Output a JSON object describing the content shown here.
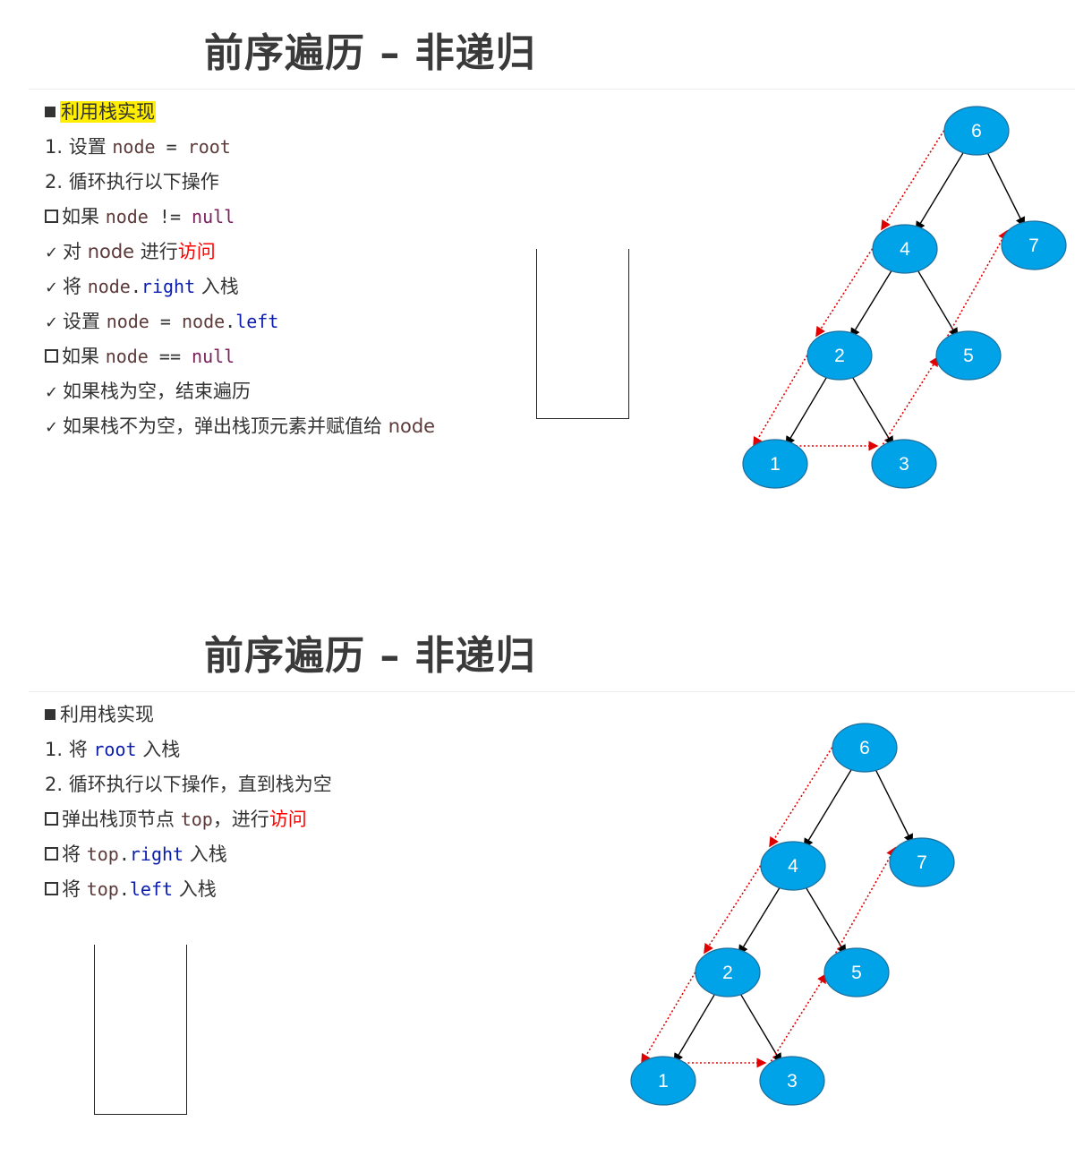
{
  "slides": [
    {
      "title": "前序遍历 – 非递归",
      "lines": [
        {
          "bullet": "square",
          "parts": [
            {
              "t": "利用栈实现",
              "cls": "hl"
            }
          ]
        },
        {
          "bullet": "none",
          "parts": [
            {
              "t": "1.  设置 "
            },
            {
              "t": "node",
              "cls": "code kw-var"
            },
            {
              "t": " = ",
              "cls": "code"
            },
            {
              "t": "root",
              "cls": "code kw-var"
            }
          ]
        },
        {
          "bullet": "none",
          "parts": [
            {
              "t": "2.  循环执行以下操作"
            }
          ]
        },
        {
          "bullet": "box",
          "parts": [
            {
              "t": "如果 "
            },
            {
              "t": "node",
              "cls": "code kw-var"
            },
            {
              "t": " != ",
              "cls": "code"
            },
            {
              "t": "null",
              "cls": "code kw-purple"
            }
          ]
        },
        {
          "bullet": "check",
          "parts": [
            {
              "t": "对 "
            },
            {
              "t": "node",
              "cls": "kw-var"
            },
            {
              "t": " 进行"
            },
            {
              "t": "访问",
              "cls": "kw-red"
            }
          ]
        },
        {
          "bullet": "check",
          "parts": [
            {
              "t": "将 "
            },
            {
              "t": "node",
              "cls": "code kw-var"
            },
            {
              "t": ".",
              "cls": "code"
            },
            {
              "t": "right",
              "cls": "code kw-blue"
            },
            {
              "t": " 入栈"
            }
          ]
        },
        {
          "bullet": "check",
          "parts": [
            {
              "t": "设置 "
            },
            {
              "t": "node",
              "cls": "code kw-var"
            },
            {
              "t": " = ",
              "cls": "code"
            },
            {
              "t": "node",
              "cls": "code kw-var"
            },
            {
              "t": ".",
              "cls": "code"
            },
            {
              "t": "left",
              "cls": "code kw-blue"
            }
          ]
        },
        {
          "bullet": "box",
          "parts": [
            {
              "t": "如果 "
            },
            {
              "t": "node",
              "cls": "code kw-var"
            },
            {
              "t": " == ",
              "cls": "code"
            },
            {
              "t": "null",
              "cls": "code kw-purple"
            }
          ]
        },
        {
          "bullet": "check",
          "parts": [
            {
              "t": "如果栈为空，结束遍历"
            }
          ]
        },
        {
          "bullet": "check",
          "parts": [
            {
              "t": "如果栈不为空，弹出栈顶元素并赋值给 "
            },
            {
              "t": "node",
              "cls": "kw-var"
            }
          ]
        }
      ],
      "tree": {
        "nodes": [
          "6",
          "4",
          "7",
          "2",
          "5",
          "1",
          "3"
        ]
      }
    },
    {
      "title": "前序遍历 – 非递归",
      "lines": [
        {
          "bullet": "square",
          "parts": [
            {
              "t": "利用栈实现"
            }
          ]
        },
        {
          "bullet": "none",
          "parts": [
            {
              "t": "1.  将 "
            },
            {
              "t": "root",
              "cls": "code kw-blue"
            },
            {
              "t": " 入栈"
            }
          ]
        },
        {
          "bullet": "none",
          "parts": [
            {
              "t": "2.  循环执行以下操作，直到栈为空"
            }
          ]
        },
        {
          "bullet": "box",
          "parts": [
            {
              "t": "弹出栈顶节点 "
            },
            {
              "t": "top",
              "cls": "code kw-var"
            },
            {
              "t": "，进行"
            },
            {
              "t": "访问",
              "cls": "kw-red"
            }
          ]
        },
        {
          "bullet": "box",
          "parts": [
            {
              "t": "将 "
            },
            {
              "t": "top",
              "cls": "code kw-var"
            },
            {
              "t": ".",
              "cls": "code"
            },
            {
              "t": "right",
              "cls": "code kw-blue"
            },
            {
              "t": " 入栈"
            }
          ]
        },
        {
          "bullet": "box",
          "parts": [
            {
              "t": "将 "
            },
            {
              "t": "top",
              "cls": "code kw-var"
            },
            {
              "t": ".",
              "cls": "code"
            },
            {
              "t": "left",
              "cls": "code kw-blue"
            },
            {
              "t": " 入栈"
            }
          ]
        }
      ],
      "tree": {
        "nodes": [
          "6",
          "4",
          "7",
          "2",
          "5",
          "1",
          "3"
        ]
      }
    }
  ],
  "colors": {
    "node_fill": "#00a2e8",
    "node_stroke": "#1f6f9c",
    "traversal": "#e00000",
    "highlight": "#ffee00"
  }
}
